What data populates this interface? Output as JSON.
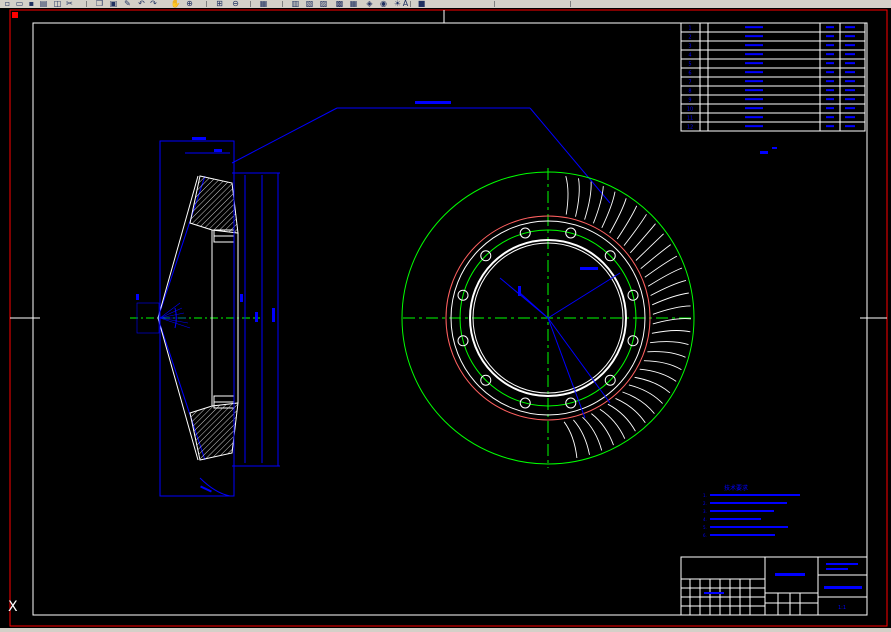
{
  "toolbar": {
    "items": [
      {
        "name": "new-icon",
        "glyph": "▫"
      },
      {
        "name": "open-icon",
        "glyph": "▭"
      },
      {
        "name": "save-icon",
        "glyph": "▪"
      },
      {
        "name": "print-icon",
        "glyph": "▤"
      },
      {
        "name": "preview-icon",
        "glyph": "◫"
      },
      {
        "name": "cut-icon",
        "glyph": "✂"
      },
      {
        "name": "copy-icon",
        "glyph": "❐"
      },
      {
        "name": "paste-icon",
        "glyph": "▣"
      },
      {
        "name": "match-properties-icon",
        "glyph": "✎"
      },
      {
        "name": "undo-icon",
        "glyph": "↶"
      },
      {
        "name": "redo-icon",
        "glyph": "↷"
      },
      {
        "name": "pan-icon",
        "glyph": "✋"
      },
      {
        "name": "zoom-realtime-icon",
        "glyph": "⊕"
      },
      {
        "name": "zoom-window-icon",
        "glyph": "⊞"
      },
      {
        "name": "zoom-previous-icon",
        "glyph": "⊖"
      },
      {
        "name": "properties-icon",
        "glyph": "▦"
      },
      {
        "name": "design-center-icon",
        "glyph": "▥"
      },
      {
        "name": "tool-palettes-icon",
        "glyph": "▧"
      },
      {
        "name": "sheet-set-icon",
        "glyph": "▨"
      },
      {
        "name": "markup-icon",
        "glyph": "▩"
      },
      {
        "name": "quick-calc-icon",
        "glyph": "▦"
      },
      {
        "name": "layer-manager-icon",
        "glyph": "◈"
      },
      {
        "name": "layer-state-icon",
        "glyph": "◉"
      },
      {
        "name": "layer-lightbulb-icon",
        "glyph": "☀"
      },
      {
        "name": "layer-color-icon",
        "glyph": "■"
      }
    ],
    "text_button_label": "A"
  },
  "drawing": {
    "colors": {
      "background": "#000000",
      "border": "#ff0000",
      "frame": "#ffffff",
      "centerline": "#00ff00",
      "dimension": "#0000ff",
      "hatch": "#ffffff",
      "text": "#0000ff"
    },
    "ucs_icon_label": "X",
    "parameter_table": {
      "rows": [
        [
          "1",
          "",
          "",
          "",
          ""
        ],
        [
          "2",
          "",
          "",
          "",
          ""
        ],
        [
          "3",
          "",
          "",
          "",
          ""
        ],
        [
          "4",
          "",
          "",
          "",
          ""
        ],
        [
          "5",
          "",
          "",
          "",
          ""
        ],
        [
          "6",
          "",
          "",
          "",
          ""
        ],
        [
          "7",
          "",
          "",
          "",
          ""
        ],
        [
          "8",
          "",
          "",
          "",
          ""
        ],
        [
          "9",
          "",
          "",
          "",
          ""
        ],
        [
          "10",
          "",
          "",
          "",
          ""
        ],
        [
          "11",
          "",
          "",
          "",
          ""
        ],
        [
          "12",
          "",
          "",
          "",
          ""
        ]
      ]
    },
    "tech_requirements_title": "技术要求",
    "tech_requirements_lines": [
      "1. ",
      "2. ",
      "3. ",
      "4. ",
      "5. ",
      "6. "
    ],
    "title_block": {
      "drawing_name": "",
      "scale": "1:1",
      "number": "",
      "material": ""
    }
  }
}
